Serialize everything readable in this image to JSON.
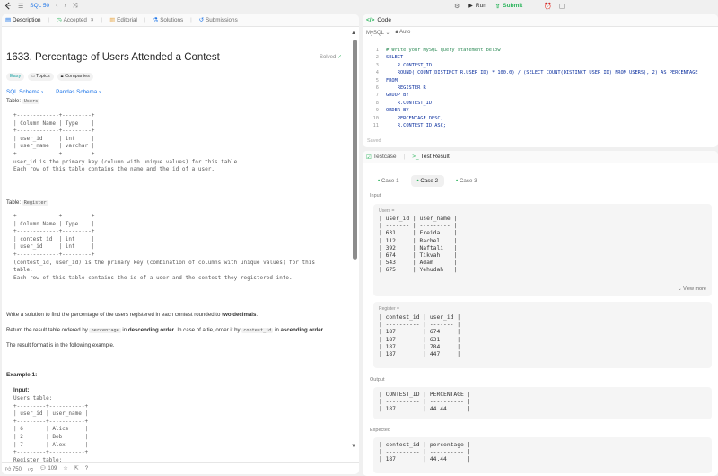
{
  "topbar": {
    "nav_label": "SQL 50",
    "run_label": "Run",
    "submit_label": "Submit"
  },
  "left": {
    "tabs": {
      "description": "Description",
      "accepted": "Accepted",
      "editorial": "Editorial",
      "solutions": "Solutions",
      "submissions": "Submissions"
    },
    "title": "1633. Percentage of Users Attended a Contest",
    "solved": "Solved",
    "chips": {
      "easy": "Easy",
      "topics": "Topics",
      "companies": "Companies"
    },
    "schema": {
      "sql": "SQL Schema",
      "pandas": "Pandas Schema"
    },
    "table_users_prefix": "Table: ",
    "table_users_name": "Users",
    "users_schema": "+-------------+---------+\n| Column Name | Type    |\n+-------------+---------+\n| user_id     | int     |\n| user_name   | varchar |\n+-------------+---------+\nuser_id is the primary key (column with unique values) for this table.\nEach row of this table contains the name and the id of a user.",
    "table_register_prefix": "Table: ",
    "table_register_name": "Register",
    "register_schema": "+-------------+---------+\n| Column Name | Type    |\n+-------------+---------+\n| contest_id  | int     |\n| user_id     | int     |\n+-------------+---------+\n(contest_id, user_id) is the primary key (combination of columns with unique values) for this\ntable.\nEach row of this table contains the id of a user and the contest they registered into.",
    "p1_a": "Write a solution to find the percentage of the users registered in each contest rounded to ",
    "p1_b": "two decimals",
    "p1_c": ".",
    "p2_a": "Return the result table ordered by ",
    "p2_code1": "percentage",
    "p2_b": " in ",
    "p2_c": "descending order",
    "p2_d": ". In case of a tie, order it by ",
    "p2_code2": "contest_id",
    "p2_e": " in ",
    "p2_f": "ascending order",
    "p2_g": ".",
    "p3": "The result format is in the following example.",
    "example_title": "Example 1:",
    "input_label": "Input:",
    "example_block": "Users table:\n+---------+-----------+\n| user_id | user_name |\n+---------+-----------+\n| 6       | Alice     |\n| 2       | Bob       |\n| 7       | Alex      |\n+---------+-----------+\nRegister table:",
    "footer": {
      "likes": "750",
      "comments": "109"
    }
  },
  "code": {
    "header": "Code",
    "lang": "MySQL",
    "auto": "Auto",
    "lines": [
      {
        "n": "1",
        "t": "# Write your MySQL query statement below"
      },
      {
        "n": "2",
        "t": "SELECT"
      },
      {
        "n": "3",
        "t": "    R.CONTEST_ID,"
      },
      {
        "n": "4",
        "t": "    ROUND((COUNT(DISTINCT R.USER_ID) * 100.0) / (SELECT COUNT(DISTINCT USER_ID) FROM USERS), 2) AS PERCENTAGE"
      },
      {
        "n": "5",
        "t": "FROM"
      },
      {
        "n": "6",
        "t": "    REGISTER R"
      },
      {
        "n": "7",
        "t": "GROUP BY"
      },
      {
        "n": "8",
        "t": "    R.CONTEST_ID"
      },
      {
        "n": "9",
        "t": "ORDER BY"
      },
      {
        "n": "10",
        "t": "    PERCENTAGE DESC,"
      },
      {
        "n": "11",
        "t": "    R.CONTEST_ID ASC;"
      }
    ],
    "saved": "Saved"
  },
  "result": {
    "tab_testcase": "Testcase",
    "tab_result": "Test Result",
    "cases": [
      "Case 1",
      "Case 2",
      "Case 3"
    ],
    "input_label": "Input",
    "users_caption": "Users =",
    "users_table": "| user_id | user_name |\n| ------- | --------- |\n| 631     | Freida    |\n| 112     | Rachel    |\n| 392     | Naftali   |\n| 674     | Tikvah    |\n| 543     | Adam      |\n| 675     | Yehudah   |",
    "view_more": "View more",
    "register_caption": "Register =",
    "register_table": "| contest_id | user_id |\n| ---------- | ------- |\n| 187        | 674     |\n| 187        | 631     |\n| 187        | 784     |\n| 187        | 447     |",
    "output_label": "Output",
    "output_table": "| CONTEST_ID | PERCENTAGE |\n| ---------- | ---------- |\n| 187        | 44.44      |",
    "expected_label": "Expected",
    "expected_table": "| contest_id | percentage |\n| ---------- | ---------- |\n| 187        | 44.44      |"
  }
}
